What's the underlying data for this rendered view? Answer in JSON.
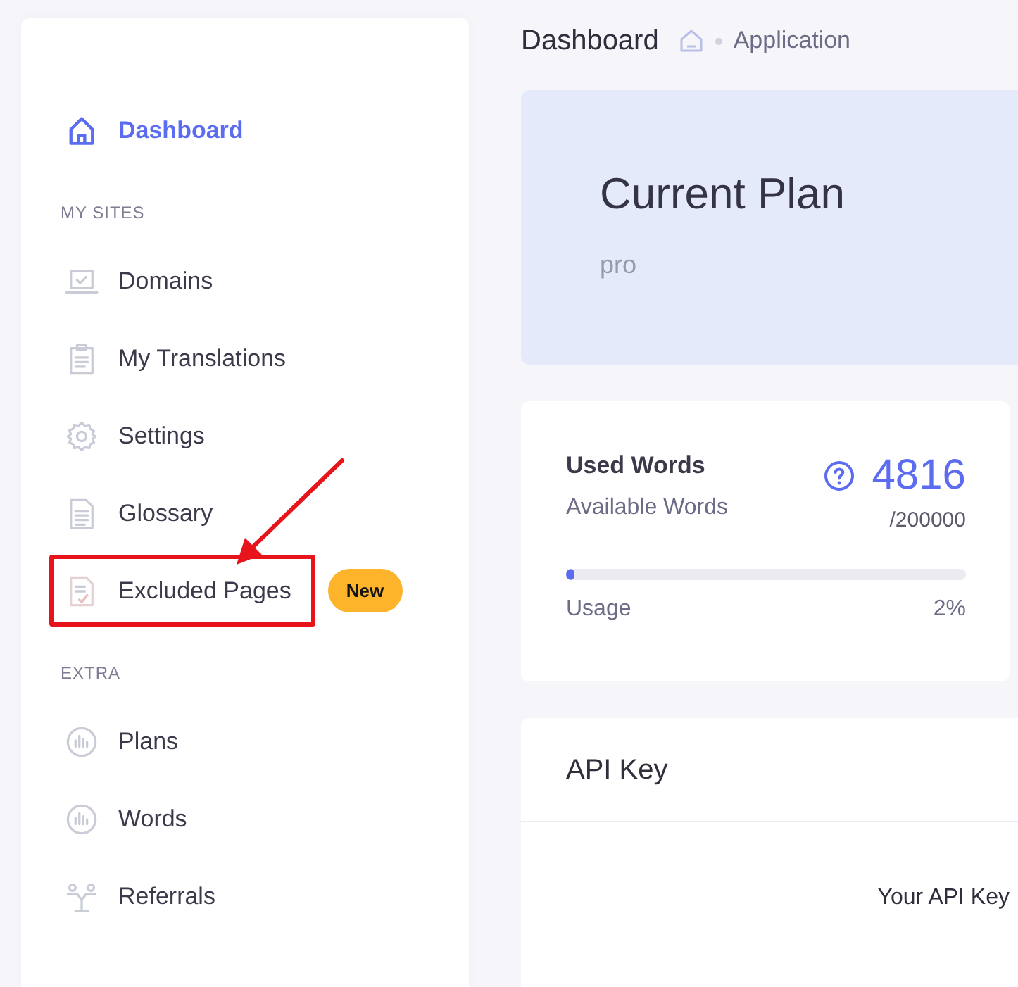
{
  "sidebar": {
    "top_items": [
      {
        "label": "Dashboard",
        "selected": true
      }
    ],
    "sections": [
      {
        "title": "MY SITES",
        "items": [
          {
            "label": "Domains",
            "selected": false
          },
          {
            "label": "My Translations",
            "selected": false
          },
          {
            "label": "Settings",
            "selected": false
          },
          {
            "label": "Glossary",
            "selected": false
          },
          {
            "label": "Excluded Pages",
            "selected": false,
            "badge": "New",
            "highlighted": true
          }
        ]
      },
      {
        "title": "EXTRA",
        "items": [
          {
            "label": "Plans",
            "selected": false
          },
          {
            "label": "Words",
            "selected": false
          },
          {
            "label": "Referrals",
            "selected": false
          }
        ]
      }
    ]
  },
  "breadcrumb": {
    "title": "Dashboard",
    "current": "Application"
  },
  "plan_card": {
    "title": "Current Plan",
    "plan": "pro"
  },
  "words_card": {
    "used_label": "Used Words",
    "available_label": "Available Words",
    "used": "4816",
    "available": "/200000",
    "usage_label": "Usage",
    "level": 0.02,
    "usage_percent": "2%"
  },
  "api_card": {
    "title": "API Key",
    "label": "Your API Key"
  }
}
